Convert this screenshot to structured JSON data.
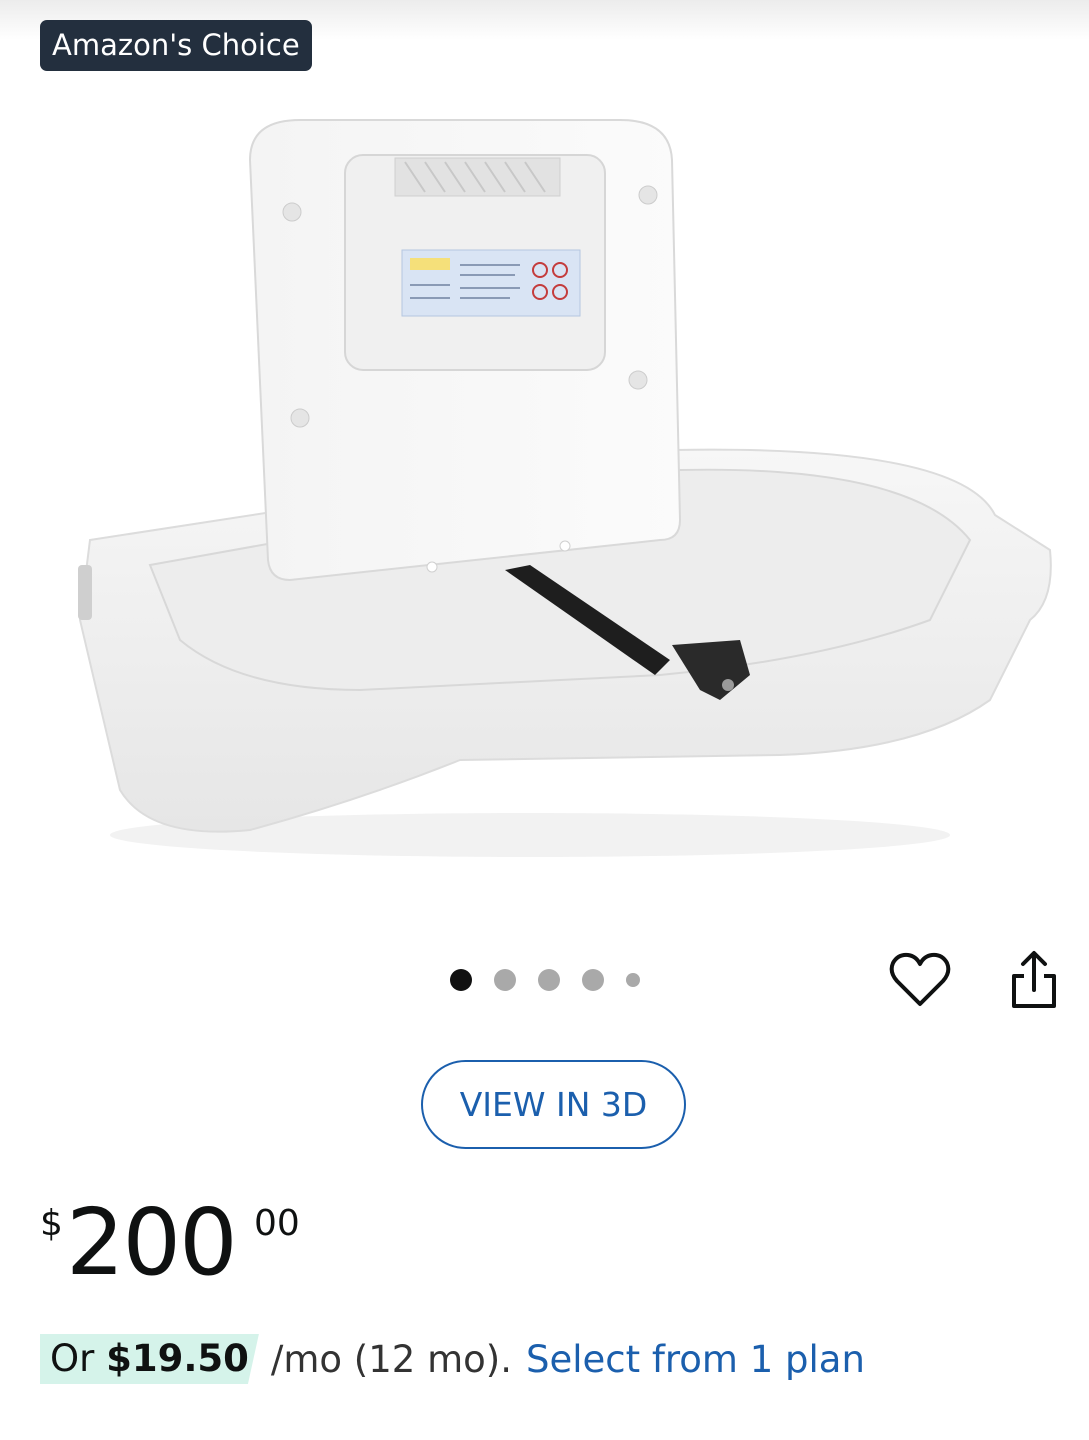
{
  "badge": {
    "label": "Amazon's Choice"
  },
  "gallery": {
    "image_count": 5,
    "active_index": 0,
    "image_alt": "Wall-mounted baby changing station"
  },
  "actions": {
    "wishlist_icon": "heart-icon",
    "share_icon": "share-icon"
  },
  "view3d": {
    "label": "VIEW IN 3D"
  },
  "price": {
    "currency": "$",
    "whole": "200",
    "fraction": "00"
  },
  "installment": {
    "prefix": "Or",
    "amount": "$19.50",
    "term": "/mo (12 mo).",
    "link_text": "Select from 1 plan"
  },
  "colors": {
    "accent": "#1b5fad",
    "badge_bg": "#232f3e",
    "highlight": "#d5f3ea"
  }
}
